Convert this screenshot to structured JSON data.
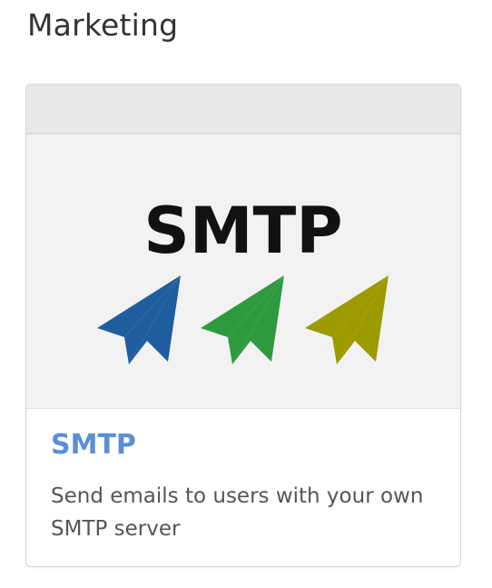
{
  "section": {
    "title": "Marketing"
  },
  "card": {
    "logo_text": "SMTP",
    "title": "SMTP",
    "description": "Send emails to users with your own SMTP server",
    "icons": [
      "paper-plane-icon",
      "paper-plane-icon",
      "paper-plane-icon"
    ]
  },
  "colors": {
    "title_link": "#5b8fd6",
    "plane_blue": "#1f5e9e",
    "plane_green": "#2e9a3f",
    "plane_olive": "#9b9b00"
  }
}
